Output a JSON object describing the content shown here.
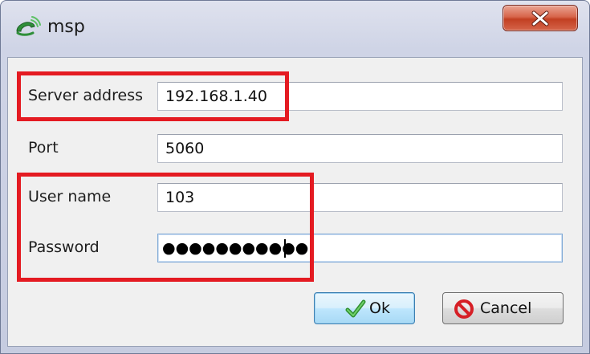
{
  "window": {
    "title": "msp"
  },
  "form": {
    "server_address": {
      "label": "Server address",
      "value": "192.168.1.40"
    },
    "port": {
      "label": "Port",
      "value": "5060"
    },
    "user_name": {
      "label": "User name",
      "value": "103"
    },
    "password": {
      "label": "Password",
      "masked_value": "●●●●●●●●●●●"
    }
  },
  "buttons": {
    "ok_label": "Ok",
    "cancel_label": "Cancel"
  },
  "icons": {
    "app": "phone-handset-icon",
    "close": "close-icon",
    "ok": "checkmark-icon",
    "cancel": "prohibited-icon"
  },
  "colors": {
    "highlight": "#e41b22",
    "close_button": "#c9452a",
    "ok_check": "#3aa53a",
    "cancel_icon": "#d61f26"
  }
}
